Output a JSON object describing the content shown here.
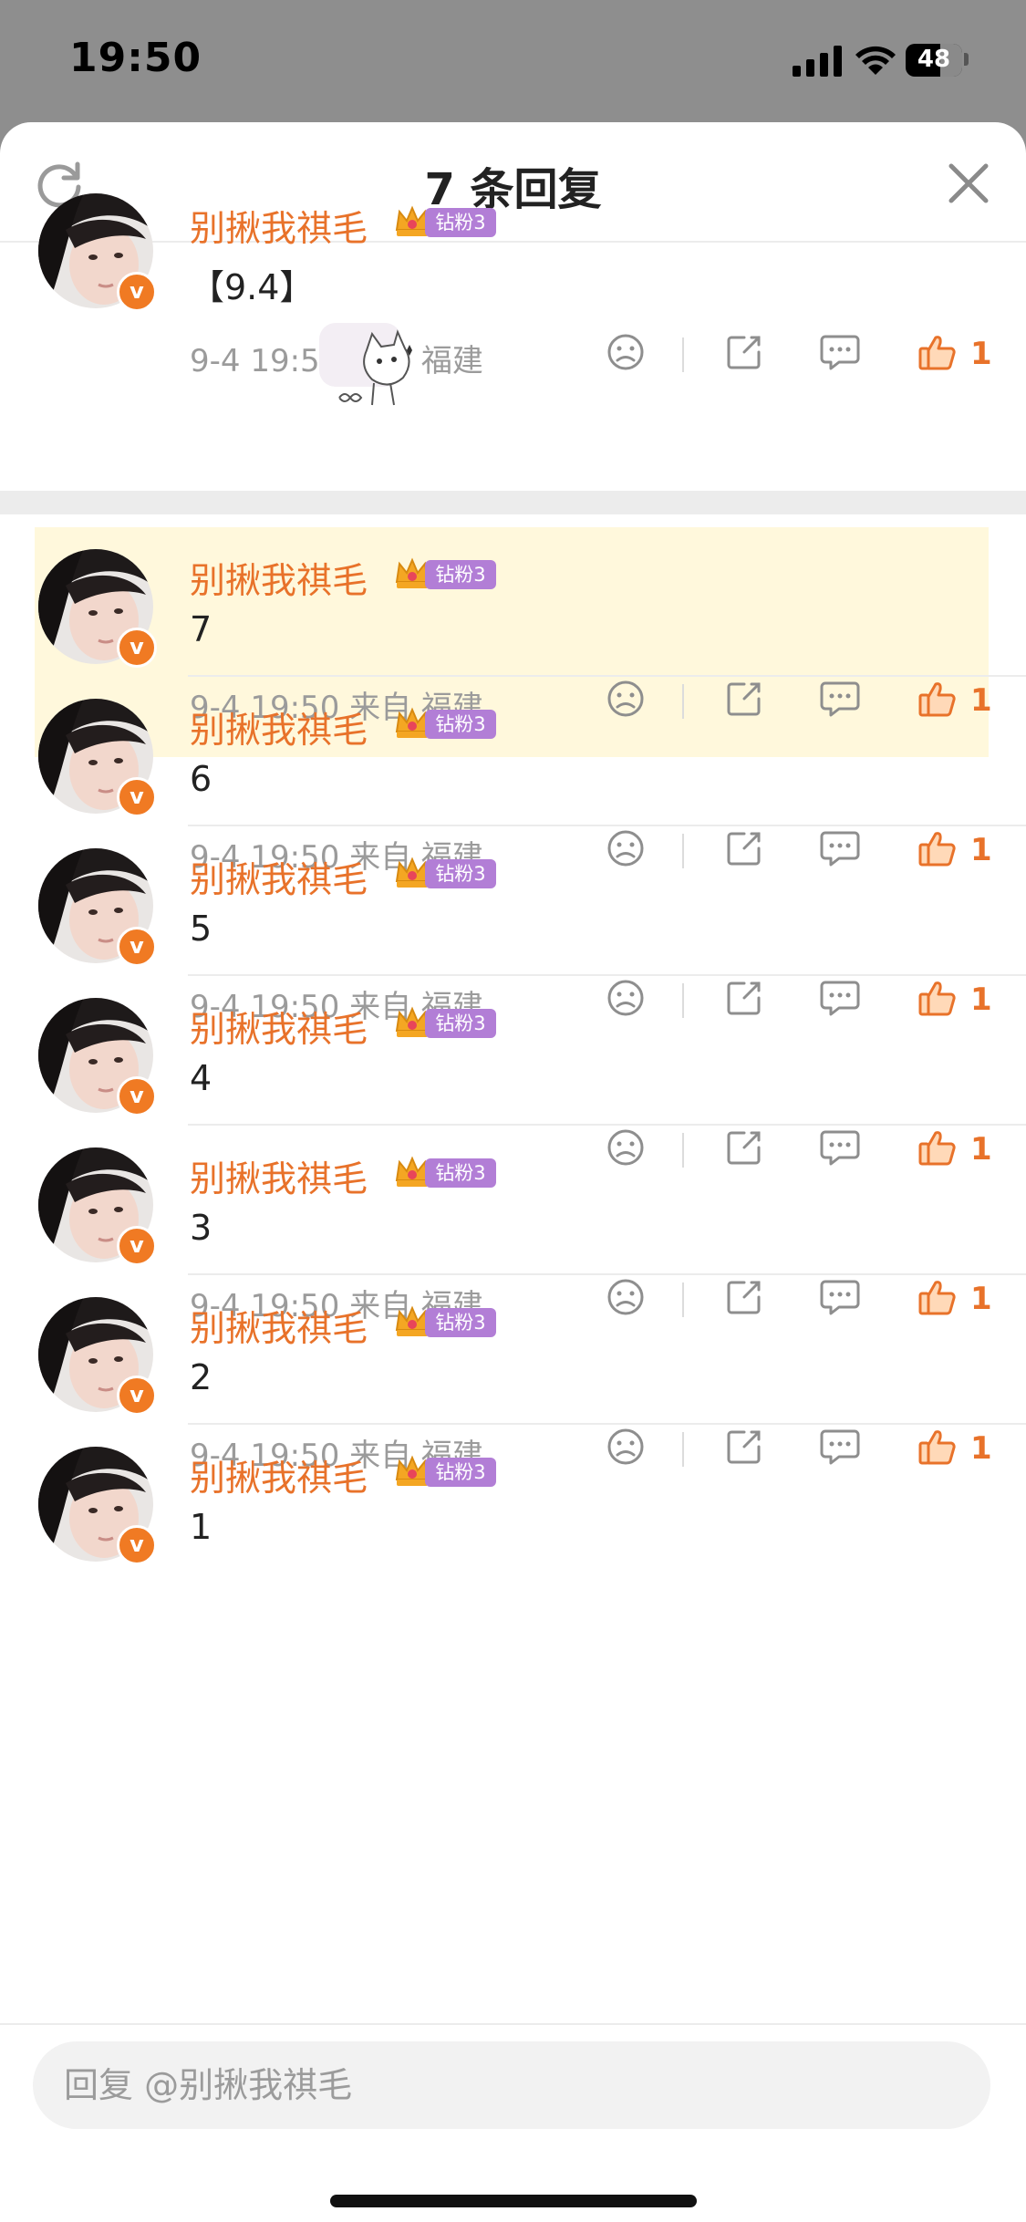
{
  "status_bar": {
    "time": "19:50",
    "battery": "48"
  },
  "header": {
    "title": "7 条回复"
  },
  "comments": [
    {
      "user": "别揪我祺毛",
      "badge": "钻粉3",
      "text": "【9.4】",
      "meta": "9-4 19:50 来自 福建",
      "likes": "1",
      "highlighted": false
    },
    {
      "user": "别揪我祺毛",
      "badge": "钻粉3",
      "text": "7",
      "meta": "9-4 19:50 来自 福建",
      "likes": "1",
      "highlighted": true
    },
    {
      "user": "别揪我祺毛",
      "badge": "钻粉3",
      "text": "6",
      "meta": "9-4 19:50 来自 福建",
      "likes": "1",
      "highlighted": false
    },
    {
      "user": "别揪我祺毛",
      "badge": "钻粉3",
      "text": "5",
      "meta": "9-4 19:50 来自 福建",
      "likes": "1",
      "highlighted": false
    },
    {
      "user": "别揪我祺毛",
      "badge": "钻粉3",
      "text": "4",
      "meta": "",
      "likes": "1",
      "highlighted": false
    },
    {
      "user": "别揪我祺毛",
      "badge": "钻粉3",
      "text": "3",
      "meta": "9-4 19:50 来自 福建",
      "likes": "1",
      "highlighted": false
    },
    {
      "user": "别揪我祺毛",
      "badge": "钻粉3",
      "text": "2",
      "meta": "9-4 19:50 来自 福建",
      "likes": "1",
      "highlighted": false
    },
    {
      "user": "别揪我祺毛",
      "badge": "钻粉3",
      "text": "1",
      "meta": "",
      "likes": "",
      "highlighted": false
    }
  ],
  "reply": {
    "placeholder": "回复 @别揪我祺毛"
  },
  "icons": {
    "refresh": "refresh-icon",
    "close": "close-icon",
    "dislike": "sad-face-icon",
    "share": "share-icon",
    "comment": "comment-icon",
    "like": "thumbs-up-icon",
    "verified": "verified-v-icon",
    "crown": "crown-icon"
  },
  "colors": {
    "accent": "#e8722a",
    "highlight": "#fff8dc",
    "fan_badge": "#b27ed6"
  }
}
